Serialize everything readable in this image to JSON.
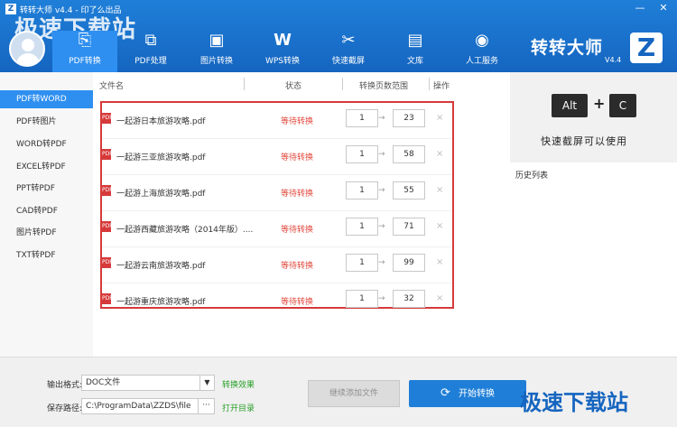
{
  "window": {
    "title": "转转大师 v4.4 - 印了么出品",
    "min": "—",
    "close": "✕",
    "watermark": "极速下载站"
  },
  "toolbar": {
    "tabs": [
      {
        "label": "PDF转换",
        "icon": "pdf-convert-icon",
        "glyph": "⎘"
      },
      {
        "label": "PDF处理",
        "icon": "pdf-process-icon",
        "glyph": "⧉"
      },
      {
        "label": "图片转换",
        "icon": "image-convert-icon",
        "glyph": "▣"
      },
      {
        "label": "WPS转换",
        "icon": "wps-icon",
        "glyph": "W"
      },
      {
        "label": "快速截屏",
        "icon": "scissors-icon",
        "glyph": "✂"
      },
      {
        "label": "文库",
        "icon": "library-icon",
        "glyph": "▤"
      },
      {
        "label": "人工服务",
        "icon": "support-icon",
        "glyph": "◉"
      }
    ],
    "active_tab": 0
  },
  "brand": {
    "name": "转转大师",
    "logo": "Z",
    "version": "V4.4"
  },
  "sidebar": {
    "items": [
      {
        "label": "PDF转WORD"
      },
      {
        "label": "PDF转图片"
      },
      {
        "label": "WORD转PDF"
      },
      {
        "label": "EXCEL转PDF"
      },
      {
        "label": "PPT转PDF"
      },
      {
        "label": "CAD转PDF"
      },
      {
        "label": "图片转PDF"
      },
      {
        "label": "TXT转PDF"
      }
    ],
    "active_index": 0
  },
  "table": {
    "headers": {
      "name": "文件名",
      "status": "状态",
      "range": "转换页数范围",
      "action": "操作"
    },
    "arrow": "→",
    "delete": "×",
    "rows": [
      {
        "name": "一起游日本旅游攻略.pdf",
        "status": "等待转换",
        "from": "1",
        "to": "23"
      },
      {
        "name": "一起游三亚旅游攻略.pdf",
        "status": "等待转换",
        "from": "1",
        "to": "58"
      },
      {
        "name": "一起游上海旅游攻略.pdf",
        "status": "等待转换",
        "from": "1",
        "to": "55"
      },
      {
        "name": "一起游西藏旅游攻略（2014年版）....",
        "status": "等待转换",
        "from": "1",
        "to": "71"
      },
      {
        "name": "一起游云南旅游攻略.pdf",
        "status": "等待转换",
        "from": "1",
        "to": "99"
      },
      {
        "name": "一起游重庆旅游攻略.pdf",
        "status": "等待转换",
        "from": "1",
        "to": "32"
      }
    ]
  },
  "promo": {
    "key1": "Alt",
    "plus": "+",
    "key2": "C",
    "text": "快速截屏可以使用"
  },
  "history": {
    "label": "历史列表"
  },
  "bottom": {
    "format_label": "输出格式:",
    "format_value": "DOC文件",
    "format_arrow": "▼",
    "effect_link": "转换效果",
    "path_label": "保存路径:",
    "path_value": "C:\\ProgramData\\ZZDS\\file",
    "browse": "···",
    "open_link": "打开目录",
    "add_more": "继续添加文件",
    "start": "开始转换",
    "start_icon": "⟳"
  }
}
